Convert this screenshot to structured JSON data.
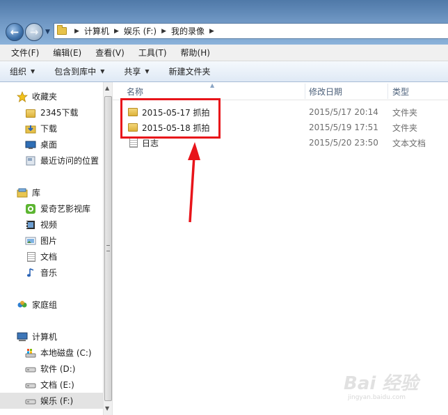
{
  "address": {
    "crumbs": [
      "计算机",
      "娱乐 (F:)",
      "我的录像"
    ]
  },
  "menu": [
    "文件(F)",
    "编辑(E)",
    "查看(V)",
    "工具(T)",
    "帮助(H)"
  ],
  "toolbar": {
    "organize": "组织",
    "include_library": "包含到库中",
    "share": "共享",
    "new_folder": "新建文件夹"
  },
  "sidebar": {
    "favorites": {
      "label": "收藏夹",
      "items": [
        "2345下载",
        "下载",
        "桌面",
        "最近访问的位置"
      ]
    },
    "libraries": {
      "label": "库",
      "items": [
        "爱奇艺影视库",
        "视频",
        "图片",
        "文档",
        "音乐"
      ]
    },
    "homegroup": "家庭组",
    "computer": {
      "label": "计算机",
      "items": [
        "本地磁盘 (C:)",
        "软件 (D:)",
        "文档 (E:)",
        "娱乐 (F:)"
      ]
    }
  },
  "columns": {
    "name": "名称",
    "date": "修改日期",
    "type": "类型"
  },
  "files": [
    {
      "name": "2015-05-17 抓拍",
      "date": "2015/5/17 20:14",
      "type": "文件夹",
      "kind": "folder"
    },
    {
      "name": "2015-05-18 抓拍",
      "date": "2015/5/19 17:51",
      "type": "文件夹",
      "kind": "folder"
    },
    {
      "name": "日志",
      "date": "2015/5/20 23:50",
      "type": "文本文档",
      "kind": "text"
    }
  ],
  "watermark": {
    "text": "Bai 经验",
    "sub": "jingyan.baidu.com"
  },
  "colors": {
    "highlight": "#e8141a",
    "arrow": "#e8141a",
    "toolbar_bg": "#dfe9f5"
  }
}
